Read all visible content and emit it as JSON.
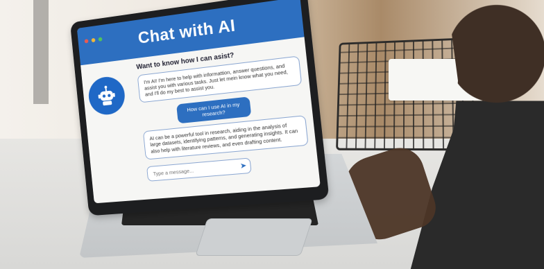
{
  "chat_window": {
    "title": "Chat with AI",
    "prompt_heading": "Want to know how I can asist?",
    "messages": [
      {
        "role": "assistant",
        "text": "I'm AI! I'm here to help with informattion, answer questions, and assist you with various tasks. Just let mein know what you need, and I'll do my best to assist you."
      },
      {
        "role": "user",
        "text": "How can I use AI in my research?"
      },
      {
        "role": "assistant",
        "text": "AI can be a powerful tool in research, aiding in the analysis of large datasets, identifying patterns, and generating insights. It can also help with literature reviews, and even drafting content."
      }
    ],
    "input": {
      "placeholder": "Type a message..."
    }
  }
}
